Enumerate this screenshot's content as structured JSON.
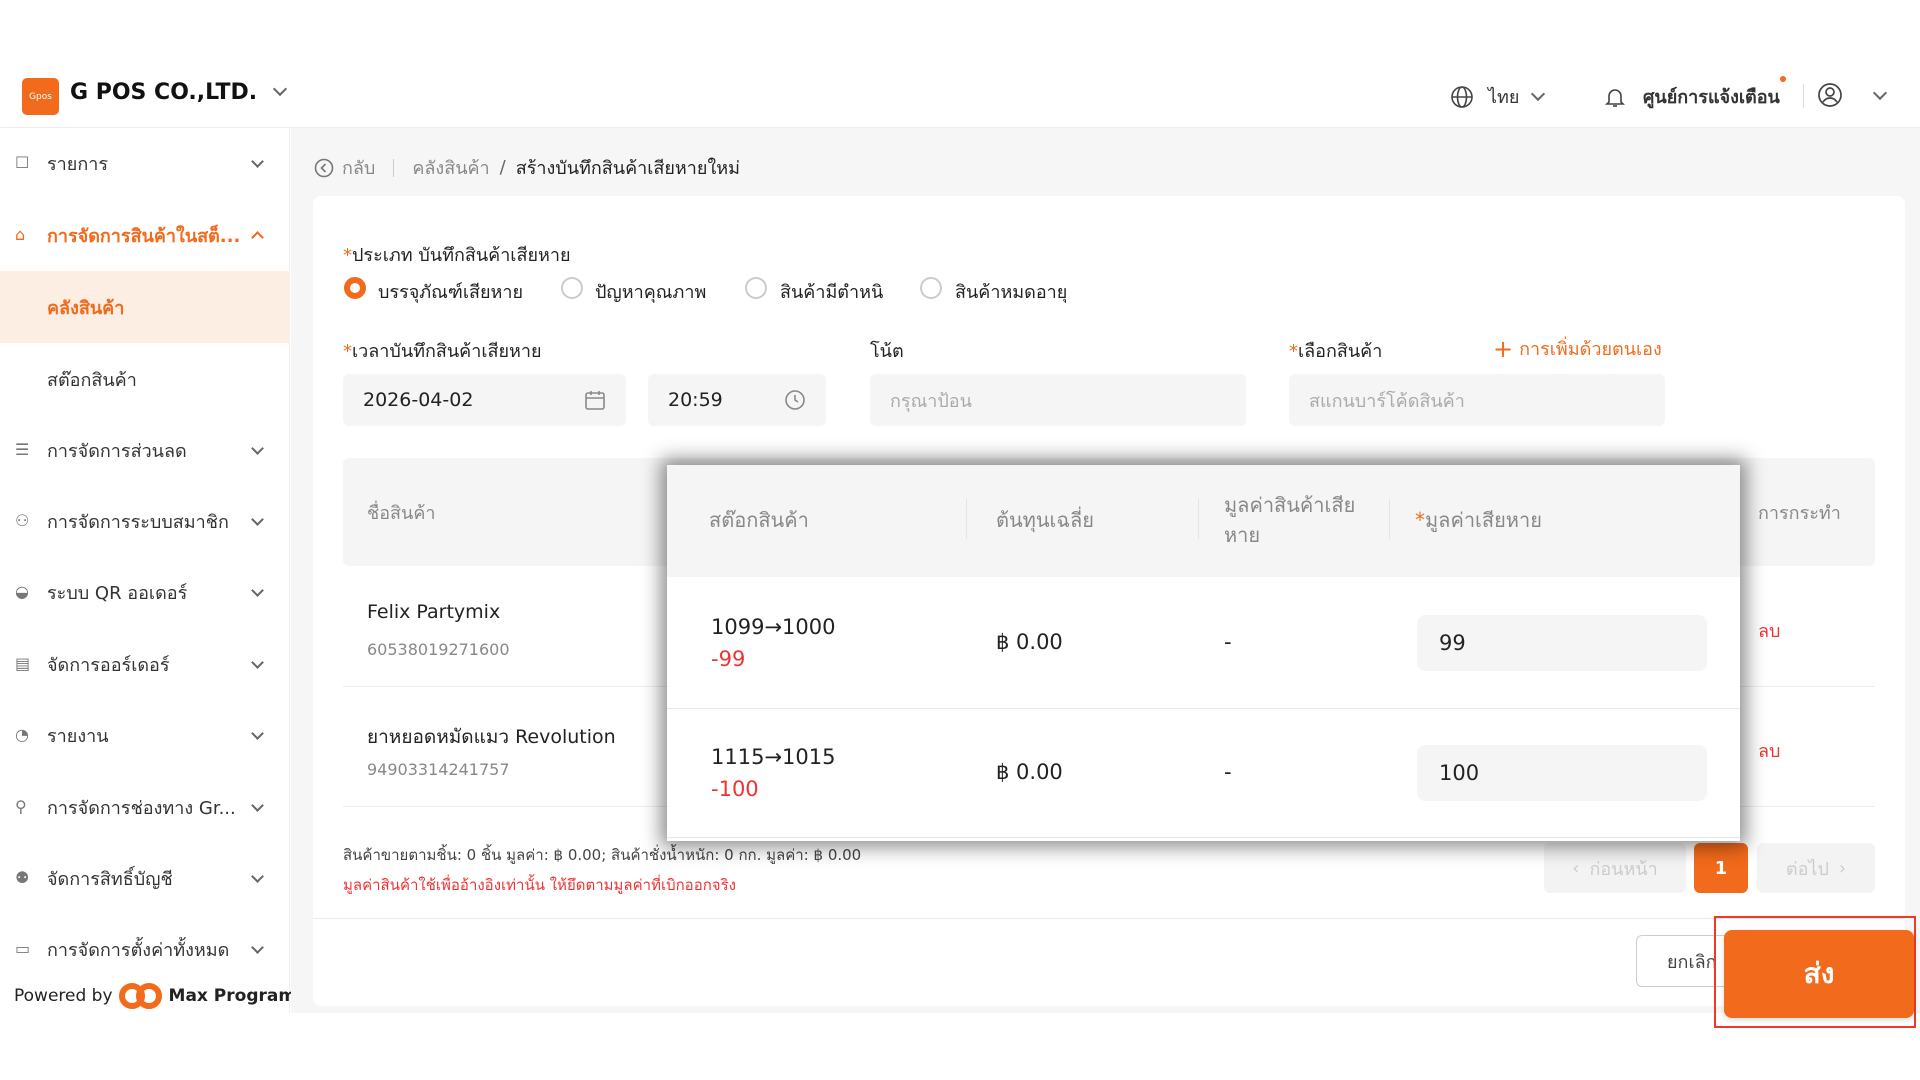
{
  "header": {
    "logo_text": "Gpos",
    "company": "G POS CO.,LTD.",
    "language": "ไทย",
    "notifications": "ศูนย์การแจ้งเตือน"
  },
  "sidebar": {
    "items": [
      {
        "label": "รายการ"
      },
      {
        "label": "การจัดการสินค้าในสต็..."
      },
      {
        "label": "การจัดการส่วนลด"
      },
      {
        "label": "การจัดการระบบสมาชิก"
      },
      {
        "label": "ระบบ QR ออเดอร์"
      },
      {
        "label": "จัดการออร์เดอร์"
      },
      {
        "label": "รายงาน"
      },
      {
        "label": "การจัดการช่องทาง Gr..."
      },
      {
        "label": "จัดการสิทธิ์บัญชี"
      },
      {
        "label": "การจัดการตั้งค่าทั้งหมด"
      }
    ],
    "sub_items": [
      {
        "label": "คลังสินค้า"
      },
      {
        "label": "สต๊อกสินค้า"
      }
    ],
    "powered_by": "Powered by",
    "powered_brand": "Max Program"
  },
  "breadcrumb": {
    "back": "กลับ",
    "parent": "คลังสินค้า",
    "separator": "/",
    "current": "สร้างบันทึกสินค้าเสียหายใหม่"
  },
  "form": {
    "type_label": "ประเภท บันทึกสินค้าเสียหาย",
    "type_options": [
      "บรรจุภัณฑ์เสียหาย",
      "ปัญหาคุณภาพ",
      "สินค้ามีตำหนิ",
      "สินค้าหมดอายุ"
    ],
    "time_label": "เวลาบันทึกสินค้าเสียหาย",
    "date_value": "2026-04-02",
    "time_value": "20:59",
    "note_label": "โน้ต",
    "note_placeholder": "กรุณาป้อน",
    "product_label": "เลือกสินค้า",
    "add_manual": "การเพิ่มด้วยตนเอง",
    "scan_placeholder": "สแกนบาร์โค้ดสินค้า"
  },
  "table": {
    "col_name": "ชื่อสินค้า",
    "col_action": "การกระทำ",
    "rows": [
      {
        "name": "Felix Partymix",
        "code": "60538019271600",
        "action": "ลบ"
      },
      {
        "name": "ยาหยอดหมัดแมว Revolution",
        "code": "94903314241757",
        "action": "ลบ"
      }
    ]
  },
  "overlay": {
    "col_stock": "สต๊อกสินค้า",
    "col_avg_cost": "ต้นทุนเฉลี่ย",
    "col_value_line1": "มูลค่าสินค้าเสีย",
    "col_value_line2": "หาย",
    "col_loss": "มูลค่าเสียหาย",
    "rows": [
      {
        "stock": "1099→1000",
        "diff": "-99",
        "cost": "฿ 0.00",
        "value": "-",
        "loss": "99"
      },
      {
        "stock": "1115→1015",
        "diff": "-100",
        "cost": "฿ 0.00",
        "value": "-",
        "loss": "100"
      }
    ]
  },
  "summary": {
    "text": "สินค้าขายตามชิ้น: 0 ชิ้น มูลค่า: ฿ 0.00; สินค้าชั่งน้ำหนัก: 0 กก. มูลค่า: ฿ 0.00",
    "warning": "มูลค่าสินค้าใช้เพื่ออ้างอิงเท่านั้น ให้ยึดตามมูลค่าที่เบิกออกจริง"
  },
  "pagination": {
    "prev": "ก่อนหน้า",
    "current": "1",
    "next": "ต่อไป"
  },
  "footer": {
    "cancel": "ยกเลิก",
    "submit": "ส่ง"
  },
  "colors": {
    "accent": "#f26a1b",
    "danger": "#e33333"
  }
}
